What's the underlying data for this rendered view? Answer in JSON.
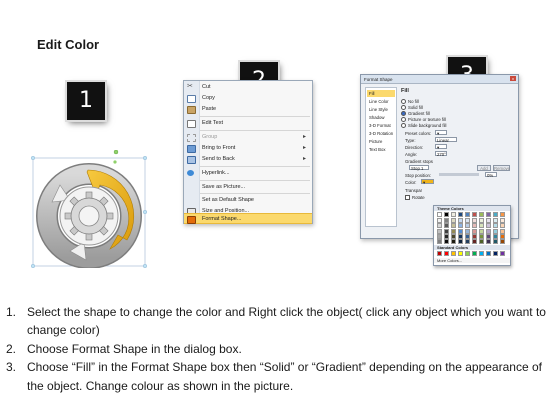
{
  "title": "Edit Color",
  "badges": [
    "1",
    "2",
    "3"
  ],
  "colors": {
    "badge_bg": "#111111",
    "arrow_gold": "#f0b41a",
    "arrow_gray": "#a8a8a8",
    "menu_highlight": "#fbd96d"
  },
  "context_menu": {
    "items": [
      {
        "label": "Cut",
        "icon": "scissors-icon"
      },
      {
        "label": "Copy",
        "icon": "copy-icon"
      },
      {
        "label": "Paste",
        "icon": "paste-icon"
      },
      {
        "label": "Edit Text",
        "icon": "text-edit-icon"
      },
      {
        "label": "Group",
        "icon": "group-icon",
        "submenu": "▸",
        "disabled": true
      },
      {
        "label": "Bring to Front",
        "icon": "bring-front-icon",
        "submenu": "▸"
      },
      {
        "label": "Send to Back",
        "icon": "send-back-icon",
        "submenu": "▸"
      },
      {
        "label": "Hyperlink...",
        "icon": "hyperlink-icon"
      },
      {
        "label": "Save as Picture...",
        "icon": ""
      },
      {
        "label": "Set as Default Shape",
        "icon": ""
      },
      {
        "label": "Size and Position...",
        "icon": "size-position-icon"
      },
      {
        "label": "Format Shape...",
        "icon": "format-shape-icon",
        "selected": true
      }
    ]
  },
  "format_dialog": {
    "title": "Format Shape",
    "close": "x",
    "nav": [
      "Fill",
      "Line Color",
      "Line Style",
      "Shadow",
      "3-D Format",
      "3-D Rotation",
      "Picture",
      "Text Box"
    ],
    "section": "Fill",
    "fill_options": [
      "No fill",
      "Solid fill",
      "Gradient fill",
      "Picture or texture fill",
      "Slide background fill"
    ],
    "selected_fill": "Gradient fill",
    "preset_colors_label": "Preset colors:",
    "type_label": "Type:",
    "type_value": "Linear",
    "direction_label": "Direction:",
    "angle_label": "Angle:",
    "angle_value": "270°",
    "gradient_stops_label": "Gradient stops",
    "stop_value": "Stop 1",
    "add_button": "Add",
    "remove_button": "Remove",
    "stop_position_label": "Stop position:",
    "stop_position_value": "0%",
    "color_label": "Color:",
    "transparency_label": "Transpar",
    "rotate_label": "Rotate"
  },
  "palette": {
    "theme_header": "Theme Colors",
    "standard_header": "Standard Colors",
    "more_colors": "More Colors...",
    "theme_row": [
      "#ffffff",
      "#000000",
      "#eeece1",
      "#1f497d",
      "#4f81bd",
      "#c0504d",
      "#9bbb59",
      "#8064a2",
      "#4bacc6",
      "#f79646"
    ],
    "theme_shades": [
      [
        "#f2f2f2",
        "#7f7f7f",
        "#ddd9c3",
        "#c6d9f0",
        "#dbe5f1",
        "#f2dcdb",
        "#ebf1dd",
        "#e5e0ec",
        "#dbeef3",
        "#fdeada"
      ],
      [
        "#d8d8d8",
        "#595959",
        "#c4bd97",
        "#8db3e2",
        "#b8cce4",
        "#e5b9b7",
        "#d7e3bc",
        "#ccc1d9",
        "#b7dde8",
        "#fbd5b5"
      ],
      [
        "#bfbfbf",
        "#3f3f3f",
        "#938953",
        "#548dd4",
        "#95b3d7",
        "#d99694",
        "#c3d69b",
        "#b2a2c7",
        "#92cddc",
        "#fac08f"
      ],
      [
        "#a5a5a5",
        "#262626",
        "#494429",
        "#17365d",
        "#366092",
        "#953734",
        "#76923c",
        "#5f497a",
        "#31859b",
        "#e36c09"
      ],
      [
        "#7f7f7f",
        "#0c0c0c",
        "#1d1b10",
        "#0f243e",
        "#244061",
        "#632423",
        "#4f6128",
        "#3f3151",
        "#205867",
        "#974806"
      ]
    ],
    "standard_row": [
      "#c00000",
      "#ff0000",
      "#ffc000",
      "#ffff00",
      "#92d050",
      "#00b050",
      "#00b0f0",
      "#0070c0",
      "#002060",
      "#7030a0"
    ]
  },
  "steps": [
    {
      "num": "1.",
      "text": "Select the shape to change the color and Right click the object( click any object which you want to change color)"
    },
    {
      "num": "2.",
      "text": "Choose Format Shape in the dialog box."
    },
    {
      "num": "3.",
      "text": "Choose “Fill” in the Format Shape box then “Solid” or “Gradient” depending on the appearance of the object. Change colour as shown in the picture."
    }
  ]
}
